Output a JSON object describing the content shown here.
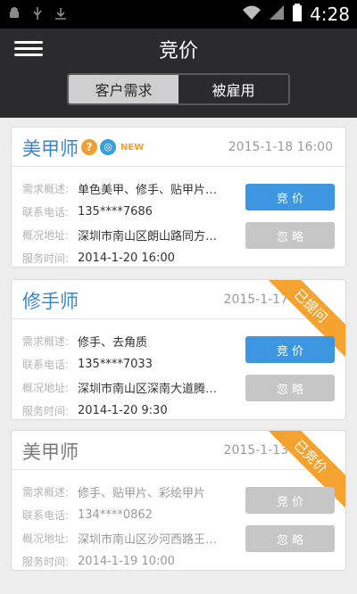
{
  "status": {
    "time": "4:28"
  },
  "header": {
    "title": "竞价",
    "tabs": [
      {
        "label": "客户需求",
        "active": true
      },
      {
        "label": "被雇用",
        "active": false
      }
    ]
  },
  "labels": {
    "demand": "需求概述:",
    "phone": "联系电话:",
    "address": "概况地址:",
    "time": "服务时间:"
  },
  "cards": [
    {
      "name": "美甲师",
      "date": "2015-1-18  16:00",
      "badges": {
        "q": "?",
        "v": "◎",
        "new": "NEW"
      },
      "demand": "单色美甲、修手、贴甲片…",
      "phone": "135****7686",
      "address": "深圳市南山区朗山路同方…",
      "service_time": "2014-1-20  16:00",
      "bid_label": "竞 价",
      "ignore_label": "忽 略"
    },
    {
      "name": "修手师",
      "date": "2015-1-17",
      "ribbon": "已提问",
      "demand": "修手、去角质",
      "phone": "135****7033",
      "address": "深圳市南山区深南大道腾…",
      "service_time": "2014-1-20  9:30",
      "bid_label": "竞 价",
      "ignore_label": "忽 略"
    },
    {
      "name": "美甲师",
      "date": "2015-1-13",
      "ribbon": "已竞价",
      "demand": "修手、贴甲片、彩绘甲片",
      "phone": "134****0862",
      "address": "深圳市南山区沙河西路王…",
      "service_time": "2014-1-19  10:00",
      "bid_label": "竞 价",
      "ignore_label": "忽 略"
    }
  ],
  "colors": {
    "header_bg": "#2b2b2d",
    "accent_blue": "#3d97e0",
    "ribbon_orange": "#f5a32e",
    "disabled_gray": "#c6c6c6"
  }
}
